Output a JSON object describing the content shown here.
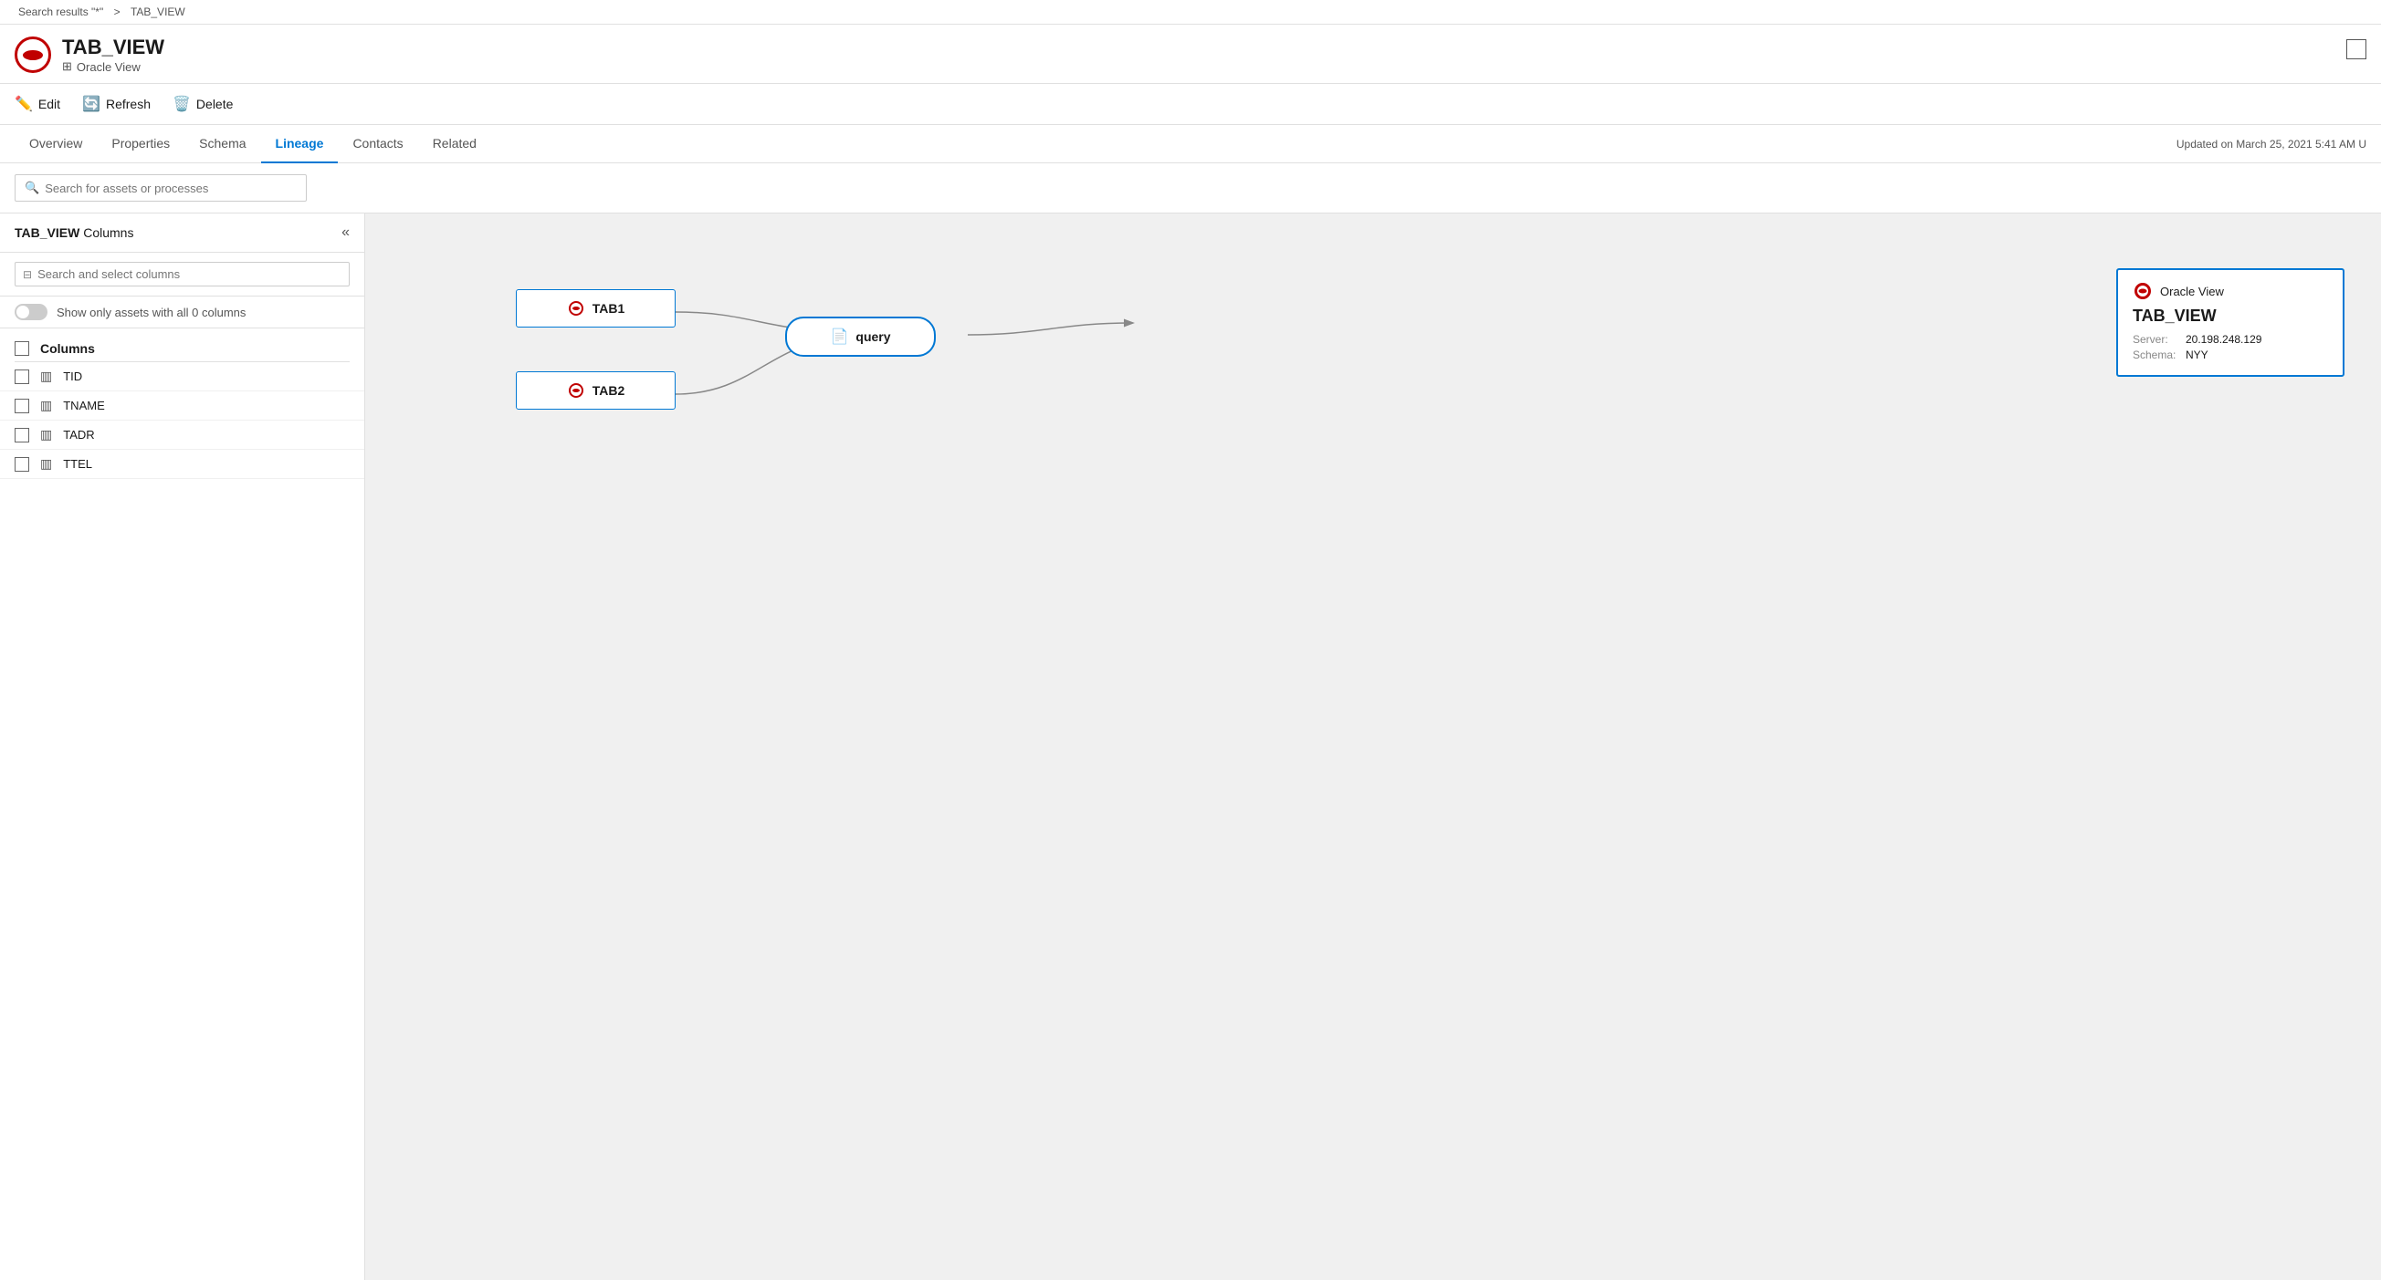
{
  "breadcrumb": {
    "search_link": "Search results \"*\"",
    "separator": ">",
    "current": "TAB_VIEW"
  },
  "asset": {
    "title": "TAB_VIEW",
    "subtitle": "Oracle View",
    "maximize_label": "maximize"
  },
  "toolbar": {
    "edit_label": "Edit",
    "refresh_label": "Refresh",
    "delete_label": "Delete"
  },
  "tabs": [
    {
      "label": "Overview",
      "active": false
    },
    {
      "label": "Properties",
      "active": false
    },
    {
      "label": "Schema",
      "active": false
    },
    {
      "label": "Lineage",
      "active": true
    },
    {
      "label": "Contacts",
      "active": false
    },
    {
      "label": "Related",
      "active": false
    }
  ],
  "updated_text": "Updated on March 25, 2021 5:41 AM U",
  "search_bar": {
    "placeholder": "Search for assets or processes"
  },
  "left_panel": {
    "title_bold": "TAB_VIEW",
    "title_suffix": " Columns",
    "filter_placeholder": "Search and select columns",
    "toggle_label": "Show only assets with all 0 columns",
    "columns_header": "Columns",
    "columns": [
      {
        "name": "TID"
      },
      {
        "name": "TNAME"
      },
      {
        "name": "TADR"
      },
      {
        "name": "TTEL"
      }
    ]
  },
  "lineage": {
    "node_tab1": "TAB1",
    "node_tab2": "TAB2",
    "node_query": "query",
    "detail_type": "Oracle View",
    "detail_name": "TAB_VIEW",
    "detail_server_key": "Server:",
    "detail_server_val": "20.198.248.129",
    "detail_schema_key": "Schema:",
    "detail_schema_val": "NYY"
  }
}
